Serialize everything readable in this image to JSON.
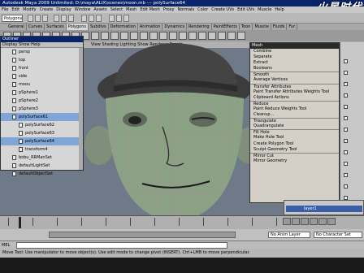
{
  "window": {
    "title": "Autodesk Maya 2009 Unlimited: D:\\maya\\ALIX\\scenes\\moon.mb  ---  polySurface64",
    "watermark": "火星时代"
  },
  "menubar": [
    "File",
    "Edit",
    "Modify",
    "Create",
    "Display",
    "Window",
    "Assets",
    "Select",
    "Mesh",
    "Edit Mesh",
    "Proxy",
    "Normals",
    "Color",
    "Create UVs",
    "Edit UVs",
    "Muscle",
    "Help"
  ],
  "toolbar": {
    "mode": "Polygons"
  },
  "shelf": {
    "tabs": [
      "General",
      "Curves",
      "Surfaces",
      "Polygons",
      "Subdivs",
      "Deformation",
      "Animation",
      "Dynamics",
      "Rendering",
      "PaintEffects",
      "Toon",
      "Muscle",
      "Fluids",
      "Fur"
    ],
    "active": "Polygons"
  },
  "viewport": {
    "menu": "View  Shading  Lighting  Show  Renderer  Panels"
  },
  "outliner": {
    "title": "Outliner",
    "menu": "Display  Show  Help",
    "items": [
      {
        "label": "persp"
      },
      {
        "label": "top"
      },
      {
        "label": "front"
      },
      {
        "label": "side"
      },
      {
        "label": "moou"
      },
      {
        "label": "pSphere1"
      },
      {
        "label": "pSphere2"
      },
      {
        "label": "pSphere3"
      },
      {
        "label": "polySurface61"
      },
      {
        "label": "polySurface62"
      },
      {
        "label": "polySurface63"
      },
      {
        "label": "polySurface64"
      },
      {
        "label": "transform4"
      },
      {
        "label": "bobu_RRManSet"
      },
      {
        "label": "defaultLightSet"
      },
      {
        "label": "defaultObjectSet"
      }
    ]
  },
  "mesh_menu": {
    "title": "Mesh",
    "items": [
      {
        "label": "Combine"
      },
      {
        "label": "Separate"
      },
      {
        "label": "Extract"
      },
      {
        "label": "Booleans"
      },
      {
        "label": "Smooth"
      },
      {
        "label": "Average Vertices"
      },
      {
        "label": "Transfer Attributes"
      },
      {
        "label": "Paint Transfer Attributes Weights Tool"
      },
      {
        "label": "Clipboard Actions"
      },
      {
        "label": "Reduce"
      },
      {
        "label": "Paint Reduce Weights Tool"
      },
      {
        "label": "Cleanup..."
      },
      {
        "label": "Triangulate"
      },
      {
        "label": "Quadrangulate"
      },
      {
        "label": "Fill Hole"
      },
      {
        "label": "Make Hole Tool"
      },
      {
        "label": "Create Polygon Tool"
      },
      {
        "label": "Sculpt Geometry Tool"
      },
      {
        "label": "Mirror Cut"
      },
      {
        "label": "Mirror Geometry"
      }
    ]
  },
  "layers": {
    "row": "layer1"
  },
  "range": {
    "anim_layer": "No Anim Layer",
    "char_set": "No Character Set"
  },
  "command": {
    "mel": "MEL"
  },
  "status": "Move Tool: Use manipulator to move object(s). Use edit mode to change pivot (INSERT). Ctrl+LMB to move perpendicular."
}
